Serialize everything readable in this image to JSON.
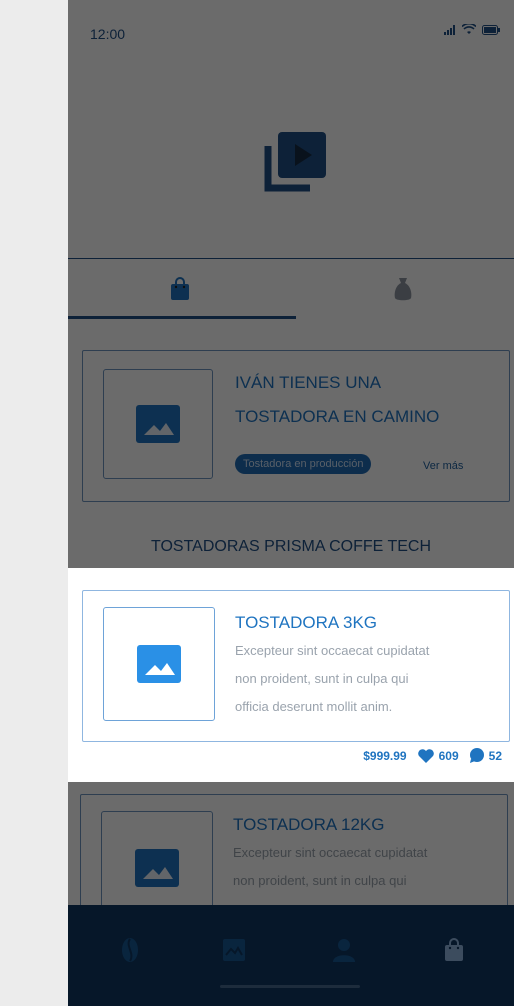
{
  "status_bar": {
    "time": "12:00"
  },
  "colors": {
    "primary": "#1f74c0",
    "dark": "#0f3762",
    "border": "#6e94bf",
    "muted": "#9aa3ad",
    "overlay": "rgba(0,0,0,0.58)"
  },
  "icons": {
    "hero": "video-library-icon",
    "tab_active": "shopping-bag-icon",
    "tab_inactive": "sack-icon",
    "image_placeholder": "image-icon",
    "likes": "heart-icon",
    "comments": "chat-bubble-icon",
    "nav": [
      "coffee-bean-icon",
      "image-gallery-icon",
      "person-icon",
      "shopping-bag-icon"
    ]
  },
  "notification_card": {
    "title_line1": "IVÁN TIENES UNA",
    "title_line2": "TOSTADORA EN CAMINO",
    "badge": "Tostadora en producción",
    "link": "Ver más"
  },
  "section": {
    "title": "TOSTADORAS PRISMA COFFE TECH"
  },
  "products": [
    {
      "title": "TOSTADORA 3KG",
      "desc_lines": [
        "Excepteur sint occaecat cupidatat",
        "non proident, sunt in culpa qui",
        "officia deserunt mollit anim."
      ],
      "price": "$999.99",
      "likes": "609",
      "comments": "52"
    },
    {
      "title": "TOSTADORA 12KG",
      "desc_lines": [
        "Excepteur sint occaecat cupidatat",
        "non proident, sunt in culpa qui"
      ]
    }
  ]
}
